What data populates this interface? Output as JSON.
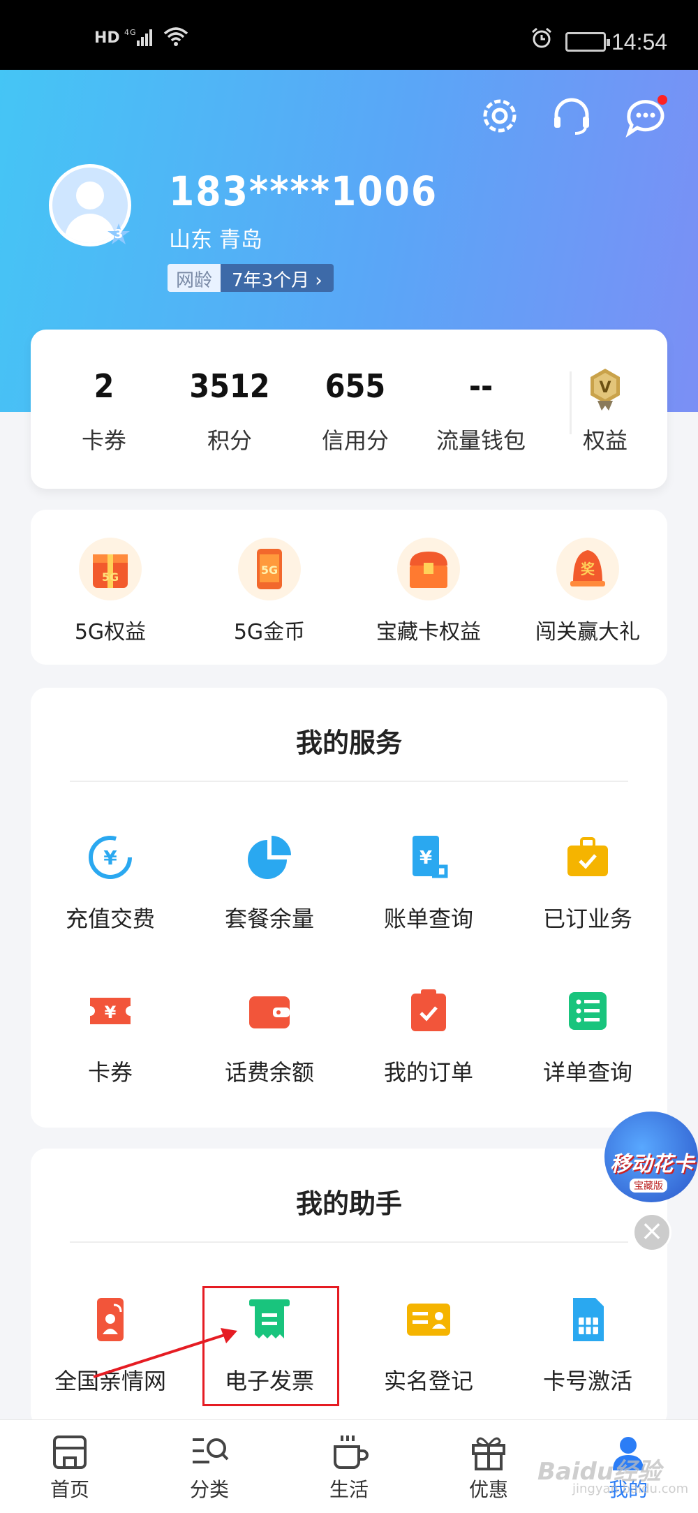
{
  "status_bar": {
    "network": "HD",
    "signal": "4G",
    "time": "14:54"
  },
  "header": {
    "phone": "183****1006",
    "location": "山东  青岛",
    "avatar_level": "3",
    "net_age_label": "网龄",
    "net_age_value": "7年3个月 ›"
  },
  "stats": [
    {
      "value": "2",
      "label": "卡券"
    },
    {
      "value": "3512",
      "label": "积分"
    },
    {
      "value": "655",
      "label": "信用分"
    },
    {
      "value": "--",
      "label": "流量钱包"
    },
    {
      "value": "",
      "label": "权益"
    }
  ],
  "promos": [
    {
      "label": "5G权益",
      "icon": "5g-gift-icon"
    },
    {
      "label": "5G金币",
      "icon": "5g-coin-icon"
    },
    {
      "label": "宝藏卡权益",
      "icon": "treasure-box-icon"
    },
    {
      "label": "闯关赢大礼",
      "icon": "prize-bell-icon"
    }
  ],
  "services": {
    "title": "我的服务",
    "items": [
      {
        "label": "充值交费",
        "icon": "recharge-icon"
      },
      {
        "label": "套餐余量",
        "icon": "pie-chart-icon"
      },
      {
        "label": "账单查询",
        "icon": "bill-icon"
      },
      {
        "label": "已订业务",
        "icon": "briefcase-icon"
      },
      {
        "label": "卡券",
        "icon": "coupon-icon"
      },
      {
        "label": "话费余额",
        "icon": "wallet-icon"
      },
      {
        "label": "我的订单",
        "icon": "clipboard-check-icon"
      },
      {
        "label": "详单查询",
        "icon": "list-icon"
      }
    ]
  },
  "helper": {
    "title": "我的助手",
    "items": [
      {
        "label": "全国亲情网",
        "icon": "family-net-icon"
      },
      {
        "label": "电子发票",
        "icon": "invoice-icon"
      },
      {
        "label": "实名登记",
        "icon": "id-card-icon"
      },
      {
        "label": "卡号激活",
        "icon": "sim-card-icon"
      }
    ]
  },
  "float_ad": {
    "title": "移动花卡",
    "sub": "宝藏版"
  },
  "bottom_nav": [
    {
      "label": "首页",
      "icon": "home-store-icon"
    },
    {
      "label": "分类",
      "icon": "category-search-icon"
    },
    {
      "label": "生活",
      "icon": "coffee-cup-icon"
    },
    {
      "label": "优惠",
      "icon": "gift-icon"
    },
    {
      "label": "我的",
      "icon": "user-icon",
      "active": true
    }
  ],
  "watermark": {
    "text": "Baidu经验",
    "sub": "jingyan.baidu.com"
  },
  "colors": {
    "header_start": "#45c5f5",
    "header_end": "#7b8ff5",
    "nav_active": "#2b7df6",
    "annotation_red": "#e51c23"
  }
}
